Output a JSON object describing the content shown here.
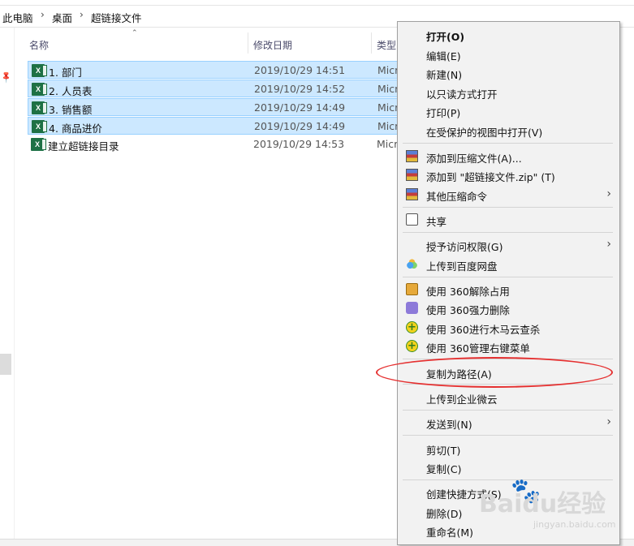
{
  "breadcrumb": [
    "此电脑",
    "桌面",
    "超链接文件"
  ],
  "columns": {
    "name": "名称",
    "modified": "修改日期",
    "type": "类型"
  },
  "files": [
    {
      "name": "1. 部门",
      "date": "2019/10/29 14:51",
      "type": "Micr",
      "selected": true
    },
    {
      "name": "2. 人员表",
      "date": "2019/10/29 14:52",
      "type": "Micr",
      "selected": true
    },
    {
      "name": "3. 销售额",
      "date": "2019/10/29 14:49",
      "type": "Micr",
      "selected": true
    },
    {
      "name": "4. 商品进价",
      "date": "2019/10/29 14:49",
      "type": "Micr",
      "selected": true
    },
    {
      "name": "建立超链接目录",
      "date": "2019/10/29 14:53",
      "type": "Micr",
      "selected": false
    }
  ],
  "file_icon_text": "X",
  "menu": {
    "open": "打开(O)",
    "edit": "编辑(E)",
    "new": "新建(N)",
    "open_readonly": "以只读方式打开",
    "print": "打印(P)",
    "open_protected": "在受保护的视图中打开(V)",
    "add_archive": "添加到压缩文件(A)...",
    "add_zip": "添加到 \"超链接文件.zip\" (T)",
    "other_archive": "其他压缩命令",
    "share": "共享",
    "grant_access": "授予访问权限(G)",
    "upload_baidu": "上传到百度网盘",
    "use_360_unlock": "使用 360解除占用",
    "use_360_delete": "使用 360强力删除",
    "use_360_scan": "使用 360进行木马云查杀",
    "use_360_manage": "使用 360管理右键菜单",
    "copy_path": "复制为路径(A)",
    "upload_wecom": "上传到企业微云",
    "send_to": "发送到(N)",
    "cut": "剪切(T)",
    "copy": "复制(C)",
    "create_shortcut": "创建快捷方式(S)",
    "delete": "删除(D)",
    "rename": "重命名(M)"
  },
  "icons": {
    "submenu": "chevron-right-icon",
    "pin": "pin-icon",
    "file": "excel-file-icon"
  },
  "watermark": {
    "brand": "Baidu经验",
    "url": "jingyan.baidu.com"
  },
  "colors": {
    "selection": "#cce8ff",
    "selection_border": "#99d1ff",
    "annotation": "#e53030",
    "menu_bg": "#f2f2f2"
  }
}
